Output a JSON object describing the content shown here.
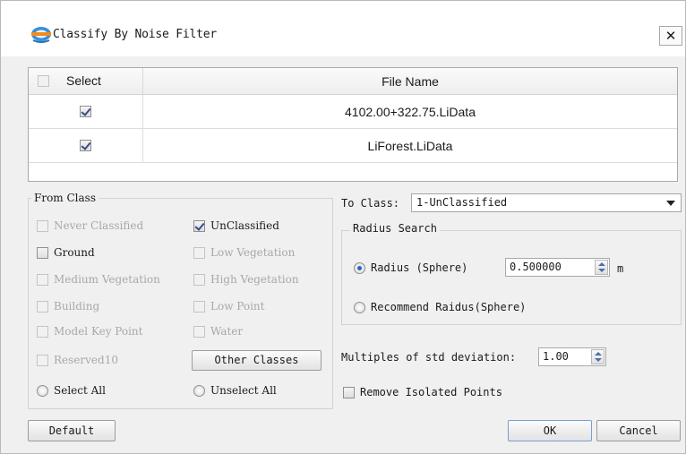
{
  "window": {
    "title": "Classify By Noise Filter",
    "close_label": "✕",
    "logo_icon": "lidar-app-logo"
  },
  "file_table": {
    "header": {
      "select_label": "Select",
      "select_all_checked": false,
      "file_label": "File Name"
    },
    "rows": [
      {
        "checked": true,
        "file": "4102.00+322.75.LiData"
      },
      {
        "checked": true,
        "file": "LiForest.LiData"
      }
    ]
  },
  "from_class": {
    "title": "From Class",
    "options": [
      {
        "label": "Never Classified",
        "checked": false,
        "enabled": false
      },
      {
        "label": "UnClassified",
        "checked": true,
        "enabled": true
      },
      {
        "label": "Ground",
        "checked": false,
        "enabled": true
      },
      {
        "label": "Low Vegetation",
        "checked": false,
        "enabled": false
      },
      {
        "label": "Medium Vegetation",
        "checked": false,
        "enabled": false
      },
      {
        "label": "High Vegetation",
        "checked": false,
        "enabled": false
      },
      {
        "label": "Building",
        "checked": false,
        "enabled": false
      },
      {
        "label": "Low Point",
        "checked": false,
        "enabled": false
      },
      {
        "label": "Model Key Point",
        "checked": false,
        "enabled": false
      },
      {
        "label": "Water",
        "checked": false,
        "enabled": false
      },
      {
        "label": "Reserved10",
        "checked": false,
        "enabled": false
      }
    ],
    "other_classes_label": "Other Classes",
    "select_all_label": "Select All",
    "unselect_all_label": "Unselect All"
  },
  "to_class": {
    "label": "To Class:",
    "value": "1-UnClassified"
  },
  "radius_search": {
    "title": "Radius Search",
    "radius_label": "Radius (Sphere)",
    "radius_value": "0.500000",
    "radius_unit": "m",
    "recommend_label": "Recommend Raidus(Sphere)",
    "selected": "radius"
  },
  "std_deviation": {
    "label": "Multiples of std deviation:",
    "value": "1.00"
  },
  "remove_isolated": {
    "label": "Remove Isolated Points",
    "checked": false
  },
  "buttons": {
    "default_label": "Default",
    "ok_label": "OK",
    "cancel_label": "Cancel"
  },
  "colors": {
    "accent": "#2a62c8",
    "check": "#3b4a8a",
    "disabled_text": "#a8a8a8"
  }
}
